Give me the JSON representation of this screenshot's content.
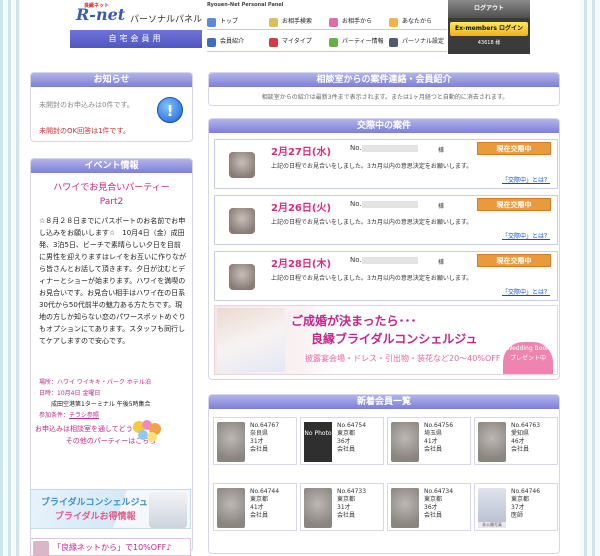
{
  "header": {
    "logo_small": "良縁ネット",
    "logo": "R-net",
    "panel_title": "パーソナルパネル",
    "home_tab": "自宅会員用",
    "nav_sub": "Ryouen-Net Personal Panel",
    "nav": [
      {
        "label": "トップ",
        "icon": "home-icon",
        "color": "#5a8ad8"
      },
      {
        "label": "お相手検索",
        "icon": "search-icon",
        "color": "#d8c05a"
      },
      {
        "label": "お相手から",
        "icon": "heart-icon",
        "color": "#e06ca8"
      },
      {
        "label": "あなたから",
        "icon": "user-icon",
        "color": "#f3b34b"
      },
      {
        "label": "会員紹介",
        "icon": "members-icon",
        "color": "#3c6ec7"
      },
      {
        "label": "マイタイプ",
        "icon": "pencil-icon",
        "color": "#d5394a"
      },
      {
        "label": "パーティー情報",
        "icon": "party-icon",
        "color": "#68b044"
      },
      {
        "label": "パーソナル設定",
        "icon": "settings-icon",
        "color": "#555a70"
      }
    ],
    "logout": "ログアウト",
    "ex_login": "Ex-members ログイン",
    "count": "43618 様"
  },
  "notice": {
    "title": "お知らせ",
    "line1": "未開封のお申込みは0件です。",
    "line2": "未開封のOK回答は1件です。",
    "icon": "info-icon"
  },
  "event": {
    "title": "イベント情報",
    "name1": "ハワイでお見合いパーティー",
    "name2": "Part2",
    "body": "☆８月２８日までにパスポートのお名前でお申し込みをお願いします☆　10月4日（金）成田発、3泊5日、ビーチで素晴らしい夕日を目前に男性を迎えりますはレイをお互いに作りながら皆さんとお話して頂きます。夕日が沈むとディナーとショーが始まります。ハワイを満喫のお見合いです。お見合い相手はハワイ在の日系30代から50代前半の魅力ある方たちです。現地の方しか知らない恋のパワースポットめぐりもオプションにてあります。スタッフも同行してケアしますので安心です。",
    "place": "場所：ハワイ ワイキキ・パーク ホテル泊",
    "date": "日時：10月4日 金曜日",
    "date2": "成田空港第1ターミナル 午後5時集合",
    "cond_label": "参加条件：",
    "cond_value": "チラシ参照",
    "apply1": "お申込みは相談室を通してどうぞ！",
    "apply2": "その他のパーティーはこちら"
  },
  "banner1": {
    "line1": "ブライダルコンシェルジュ",
    "line2": "ブライダルお得情報"
  },
  "banner2": {
    "text": "「良縁ネットから」で10%OFF♪"
  },
  "consult": {
    "title": "相談室からの案件連絡・会員紹介",
    "note": "相談室からの紹介は最新3件まで表示されます。または1ヶ月経つと自動的に消去されます。"
  },
  "cases": {
    "title": "交際中の案件",
    "items": [
      {
        "date": "2月27日(水)",
        "no": "No.",
        "sama": "様",
        "status": "現在交際中",
        "msg": "上記の日程でお見合いをしました。3カ月以内の意思決定をお願いします。",
        "link": "「交際中」とは？"
      },
      {
        "date": "2月26日(火)",
        "no": "No.",
        "sama": "様",
        "status": "現在交際中",
        "msg": "上記の日程でお見合いをしました。3カ月以内の意思決定をお願いします。",
        "link": "「交際中」とは？"
      },
      {
        "date": "2月28日(木)",
        "no": "No.",
        "sama": "様",
        "status": "現在交際中",
        "msg": "上記の日程でお見合いをしました。3カ月以内の意思決定をお願いします。",
        "link": "「交際中」とは？"
      }
    ]
  },
  "wedding": {
    "line1": "ご成婚が決まったら･･･",
    "line2": "良縁ブライダルコンシェルジュ",
    "line3": "披露宴会場・ドレス・引出物・装花など20～40%OFF",
    "badge": "Wedding Book プレゼント中"
  },
  "members": {
    "title": "新着会員一覧",
    "items": [
      {
        "no": "No.64767",
        "pref": "奈良県",
        "age": "31才",
        "job": "会社員",
        "photo": true
      },
      {
        "no": "No.64754",
        "pref": "東京都",
        "age": "36才",
        "job": "会社員",
        "photo": false,
        "nophoto": "No Photo"
      },
      {
        "no": "No.64756",
        "pref": "埼玉県",
        "age": "41才",
        "job": "会社員",
        "photo": true
      },
      {
        "no": "No.64763",
        "pref": "愛知県",
        "age": "46才",
        "job": "会社員",
        "photo": true
      },
      {
        "no": "No.64744",
        "pref": "東京都",
        "age": "41才",
        "job": "会社員",
        "photo": true
      },
      {
        "no": "No.64733",
        "pref": "東京都",
        "age": "31才",
        "job": "会社員",
        "photo": true
      },
      {
        "no": "No.64734",
        "pref": "東京都",
        "age": "36才",
        "job": "会社員",
        "photo": true
      },
      {
        "no": "No.64746",
        "pref": "東京都",
        "age": "37才",
        "job": "医師",
        "photo": true,
        "tag": "非公開写真"
      }
    ]
  }
}
